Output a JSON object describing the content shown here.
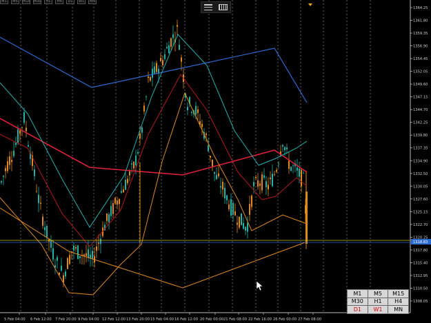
{
  "top_timeframes": [
    "M1",
    "M5",
    "M15",
    "M30",
    "H1",
    "H4",
    "D1",
    "W1",
    "MN"
  ],
  "price_axis": {
    "labels": [
      "1364.25",
      "1361.80",
      "1359.35",
      "1356.90",
      "1354.45",
      "1352.05",
      "1349.60",
      "1347.15",
      "1344.70",
      "1342.25",
      "1339.80",
      "1337.35",
      "1334.90",
      "1332.50",
      "1330.05",
      "1327.60",
      "1325.15",
      "1322.70",
      "1320.25",
      "1317.80",
      "1315.40",
      "1312.95",
      "1310.50",
      "1308.05"
    ],
    "current_price_label": "1318.83",
    "current_price_color": "#2a6cd4"
  },
  "time_axis": {
    "labels": [
      "5 Feb 04:00",
      "6 Feb 12:00",
      "7 Feb 20:00",
      "9 Feb 04:00",
      "12 Feb 12:00",
      "13 Feb 20:00",
      "15 Feb 04:00",
      "16 Feb 12:00",
      "20 Feb 00:00",
      "21 Feb 08:00",
      "22 Feb 16:00",
      "26 Feb 00:00",
      "27 Feb 08:00"
    ]
  },
  "timeframe_panel": [
    {
      "label": "M1",
      "active": false
    },
    {
      "label": "M5",
      "active": false
    },
    {
      "label": "M15",
      "active": false
    },
    {
      "label": "M30",
      "active": false
    },
    {
      "label": "H1",
      "active": false
    },
    {
      "label": "H4",
      "active": false
    },
    {
      "label": "D1",
      "active": true
    },
    {
      "label": "W1",
      "active": true
    },
    {
      "label": "MN",
      "active": false
    }
  ],
  "colors": {
    "background": "#000000",
    "bull": "#1fb3a5",
    "bear": "#e08a1e",
    "blue_ma": "#2e6bd6",
    "red_ma": "#e0203a",
    "darkred_ma": "#b81818",
    "cyan_ma": "#1fb3b3",
    "orange_ma": "#e08a1e",
    "price_line_yellow": "#c8c800",
    "price_line_blue": "#2a6cd4"
  }
}
